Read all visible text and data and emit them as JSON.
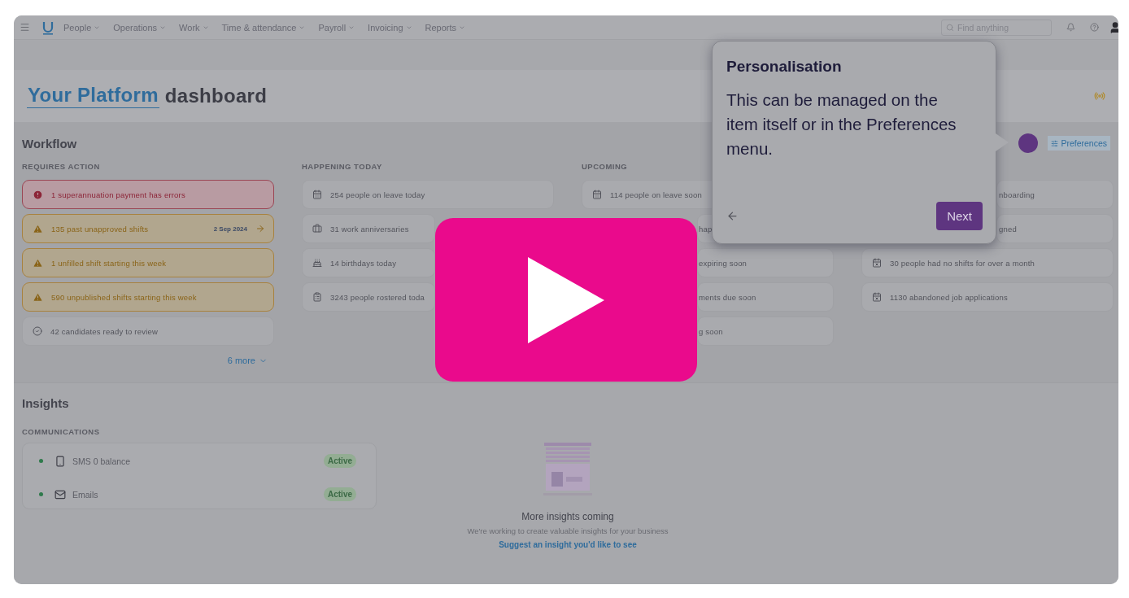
{
  "nav": {
    "items": [
      {
        "label": "People"
      },
      {
        "label": "Operations"
      },
      {
        "label": "Work"
      },
      {
        "label": "Time & attendance"
      },
      {
        "label": "Payroll"
      },
      {
        "label": "Invoicing"
      },
      {
        "label": "Reports"
      }
    ],
    "search": {
      "placeholder": "Find anything"
    }
  },
  "header": {
    "title_highlight": "Your Platform",
    "title_rest": "dashboard"
  },
  "workflow": {
    "title": "Workflow",
    "preferences_label": "Preferences",
    "columns": [
      {
        "heading": "REQUIRES ACTION",
        "items": [
          {
            "kind": "error",
            "text": "1 superannuation payment has errors"
          },
          {
            "kind": "warning",
            "text": "135 past unapproved shifts",
            "date": "2 Sep 2024"
          },
          {
            "kind": "warning",
            "text": "1 unfilled shift starting this week"
          },
          {
            "kind": "warning",
            "text": "590 unpublished shifts starting this week"
          },
          {
            "kind": "info",
            "text": "42 candidates ready to review"
          }
        ]
      },
      {
        "heading": "HAPPENING TODAY",
        "items": [
          {
            "kind": "full",
            "text": "254 people on leave today"
          },
          {
            "kind": "cut",
            "text": "31 work anniversaries"
          },
          {
            "kind": "cut",
            "text": "14 birthdays today"
          },
          {
            "kind": "cut",
            "text": "3243 people rostered toda"
          }
        ]
      },
      {
        "heading": "UPCOMING",
        "items": [
          {
            "kind": "full",
            "text": "114 people on leave soon"
          },
          {
            "kind": "clipped",
            "text": "hap"
          },
          {
            "kind": "clipped",
            "text": "expiring soon"
          },
          {
            "kind": "clipped",
            "text": "ments due soon"
          },
          {
            "kind": "clipped",
            "text": "g soon"
          }
        ]
      },
      {
        "items": [
          {
            "kind": "clipped",
            "text": "nboarding"
          },
          {
            "kind": "clipped",
            "text": "gned"
          },
          {
            "kind": "full",
            "text": "30 people had no shifts for over a month"
          },
          {
            "kind": "full",
            "text": "1130 abandoned job applications"
          }
        ]
      }
    ],
    "more_link": "6 more"
  },
  "insights": {
    "title": "Insights",
    "heading": "COMMUNICATIONS",
    "channels": [
      {
        "name": "SMS 0 balance",
        "status": "Active"
      },
      {
        "name": "Emails",
        "status": "Active"
      }
    ],
    "empty_state": {
      "title": "More insights coming",
      "text": "We're working to create valuable insights for your business",
      "link": "Suggest an insight you'd like to see"
    }
  },
  "tour_popover": {
    "title": "Personalisation",
    "body": "This can be managed on the item itself or in the Preferences menu.",
    "next_label": "Next"
  }
}
